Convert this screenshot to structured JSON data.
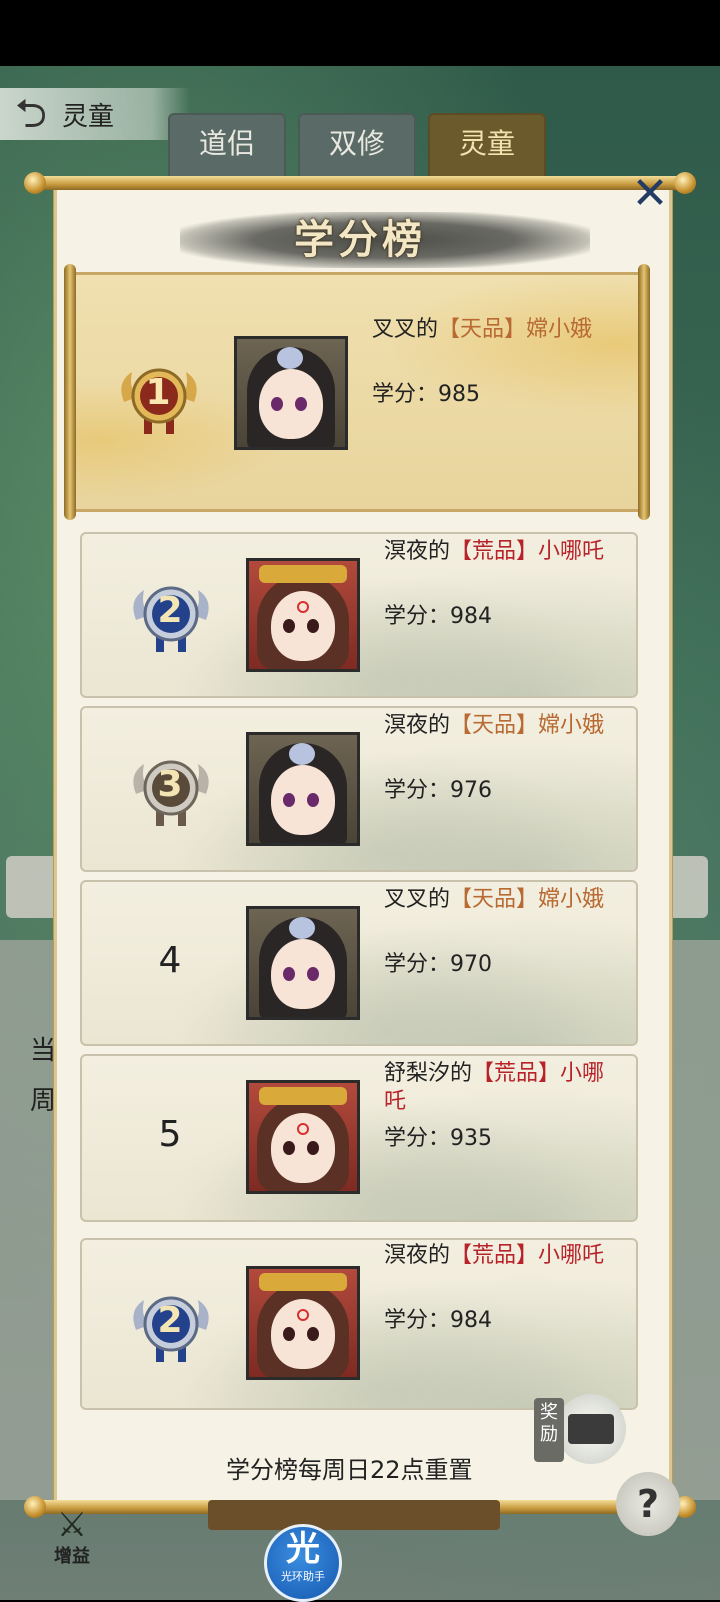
{
  "nav": {
    "back_label": "灵童",
    "tabs": [
      {
        "label": "道侣",
        "active": false
      },
      {
        "label": "双修",
        "active": false
      },
      {
        "label": "灵童",
        "active": true
      }
    ]
  },
  "background": {
    "partial_label_1": "当",
    "partial_label_2": "周"
  },
  "dialog": {
    "title": "学分榜",
    "close_icon": "close-x-icon",
    "score_prefix": "学分：",
    "rankings": [
      {
        "rank": "1",
        "owner": "叉叉的",
        "quality": "【天品】",
        "spirit": "嫦小娥",
        "score": "985",
        "avatar": "chang-xiao-e"
      },
      {
        "rank": "2",
        "owner": "溟夜的",
        "quality": "【荒品】",
        "spirit": "小哪吒",
        "score": "984",
        "avatar": "xiao-nezha"
      },
      {
        "rank": "3",
        "owner": "溟夜的",
        "quality": "【天品】",
        "spirit": "嫦小娥",
        "score": "976",
        "avatar": "chang-xiao-e"
      },
      {
        "rank": "4",
        "owner": "叉叉的",
        "quality": "【天品】",
        "spirit": "嫦小娥",
        "score": "970",
        "avatar": "chang-xiao-e"
      },
      {
        "rank": "5",
        "owner": "舒梨汐的",
        "quality": "【荒品】",
        "spirit": "小哪吒",
        "score": "935",
        "avatar": "xiao-nezha"
      }
    ],
    "my_entry": {
      "rank": "2",
      "owner": "溟夜的",
      "quality": "【荒品】",
      "spirit": "小哪吒",
      "score": "984",
      "avatar": "xiao-nezha"
    },
    "reset_note": "学分榜每周日22点重置",
    "reward_label": "奖励"
  },
  "bottom": {
    "buff_label": "增益",
    "helper_big": "光",
    "helper_small": "光环助手",
    "help_icon": "?"
  },
  "colors": {
    "quality_tian": "#b86a32",
    "quality_huang": "#b8232a",
    "rank1_badge": "#8b2a1c",
    "rank2_badge": "#24418c",
    "rank3_badge": "#5a4a3a"
  }
}
